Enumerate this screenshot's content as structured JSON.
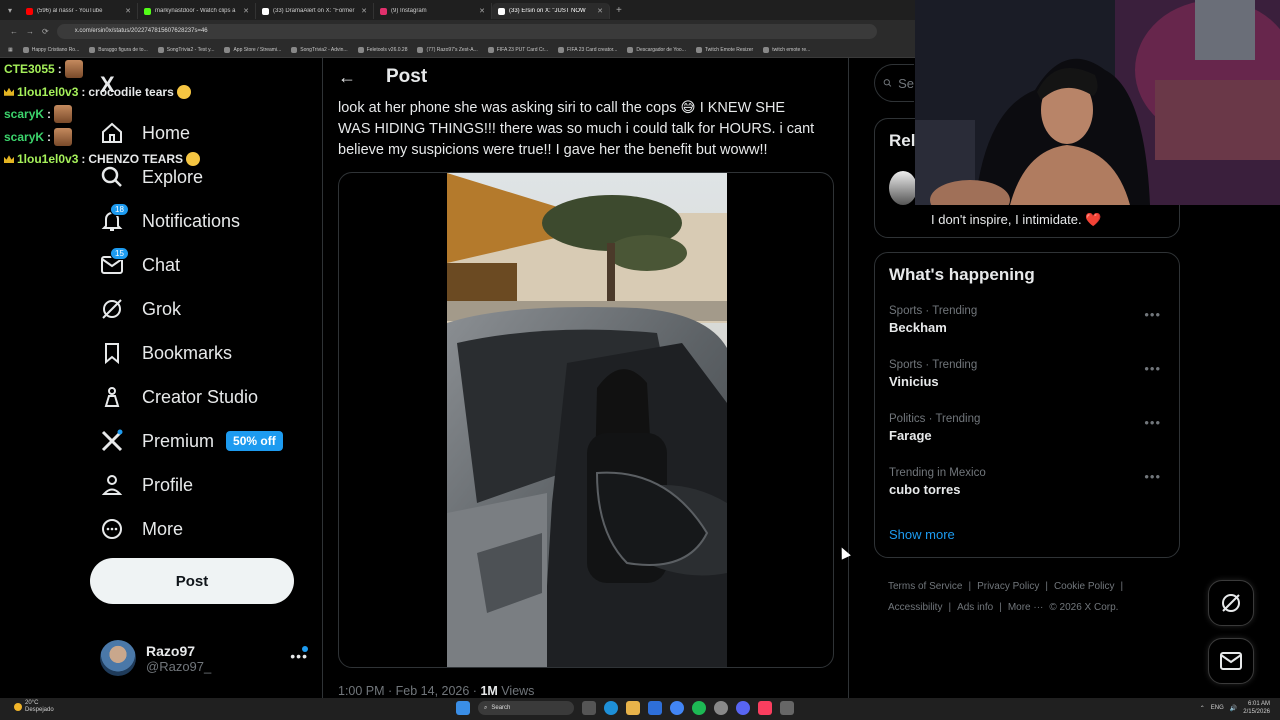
{
  "browser": {
    "tabs": [
      {
        "title": "(596) al nassr - YouTube",
        "color": "#ff0000",
        "active": false
      },
      {
        "title": "markynastdoor - Watch clips a",
        "color": "#53fc18",
        "active": false
      },
      {
        "title": "(33) DramaAlert on X: \"Former",
        "color": "#ffffff",
        "active": false
      },
      {
        "title": "(9) Instagram",
        "color": "#e1306c",
        "active": false
      },
      {
        "title": "(33) Ersin on X: \"JUST NOW",
        "color": "#ffffff",
        "active": true
      }
    ],
    "url": "x.com/ersin0x/status/2022747815607628237s=46",
    "bookmarks": [
      "Happy Cristiano Ro...",
      "Buraggo figura de to...",
      "SongTrivia2 - Test y...",
      "App Store / Streami...",
      "SongTrivia2 - Advin...",
      "Feletools v26.0.28",
      "(77) Razo97's Zest-A...",
      "FIFA 23 PUT Card Cr...",
      "FIFA 23 Card creator...",
      "Descargador de Yoo...",
      "Twitch Emote Resizer",
      "twitch emote re..."
    ]
  },
  "chat": [
    {
      "user": "CTE3055",
      "user_color": "#a5f05a",
      "message": "",
      "crown": false,
      "emote": true
    },
    {
      "user": "1lou1el0v3",
      "user_color": "#a5f05a",
      "message": "crocodile tears",
      "crown": true,
      "emote": false,
      "cry": true
    },
    {
      "user": "scaryK",
      "user_color": "#3cd46c",
      "message": "",
      "crown": false,
      "emote": true
    },
    {
      "user": "scaryK",
      "user_color": "#3cd46c",
      "message": "",
      "crown": false,
      "emote": true
    },
    {
      "user": "1lou1el0v3",
      "user_color": "#a5f05a",
      "message": "CHENZO TEARS",
      "crown": true,
      "emote": false,
      "cry": true
    }
  ],
  "sidebar": {
    "logo": "X",
    "items": [
      {
        "label": "Home",
        "icon": "home-icon"
      },
      {
        "label": "Explore",
        "icon": "search-icon"
      },
      {
        "label": "Notifications",
        "icon": "bell-icon",
        "badge": "18"
      },
      {
        "label": "Chat",
        "icon": "mail-icon",
        "badge": "15"
      },
      {
        "label": "Grok",
        "icon": "grok-icon"
      },
      {
        "label": "Bookmarks",
        "icon": "bookmark-icon"
      },
      {
        "label": "Creator Studio",
        "icon": "creator-studio-icon"
      },
      {
        "label": "Premium",
        "icon": "x-premium-icon",
        "pill": "50% off"
      },
      {
        "label": "Profile",
        "icon": "person-icon"
      },
      {
        "label": "More",
        "icon": "more-circle-icon"
      }
    ],
    "post_button": "Post",
    "account": {
      "name": "Razo97",
      "handle": "@Razo97_"
    }
  },
  "post": {
    "header_title": "Post",
    "text_lines": [
      "look at her phone she was asking siri to call the cops 😅 I KNEW SHE",
      "WAS HIDING THINGS!!! there was so much i could talk for HOURS. i cant",
      "believe my suspicions were true!! I gave her the benefit but woww!!"
    ],
    "time": "1:00 PM · Feb 14, 2026 · ",
    "views_count": "1M",
    "views_label": " Views"
  },
  "right": {
    "search_placeholder": "Se",
    "relevant_title": "Rel",
    "relevant_bio": "I don't inspire, I intimidate. ❤️",
    "happening_title": "What's happening",
    "trends": [
      {
        "category": "Sports · Trending",
        "name": "Beckham"
      },
      {
        "category": "Sports · Trending",
        "name": "Vinicius"
      },
      {
        "category": "Politics · Trending",
        "name": "Farage"
      },
      {
        "category": "Trending in Mexico",
        "name": "cubo torres"
      }
    ],
    "show_more": "Show more",
    "footer": [
      "Terms of Service",
      "Privacy Policy",
      "Cookie Policy",
      "Accessibility",
      "Ads info",
      "More ···",
      "© 2026 X Corp."
    ]
  },
  "taskbar": {
    "weather_temp": "20°C",
    "weather_desc": "Despejado",
    "search_label": "Search",
    "lang": "ENG",
    "time": "6:01 AM",
    "date": "2/15/2026"
  },
  "colors": {
    "accent": "#1d9bf0",
    "bg": "#000000",
    "border": "#2f3336",
    "muted": "#71767b"
  }
}
